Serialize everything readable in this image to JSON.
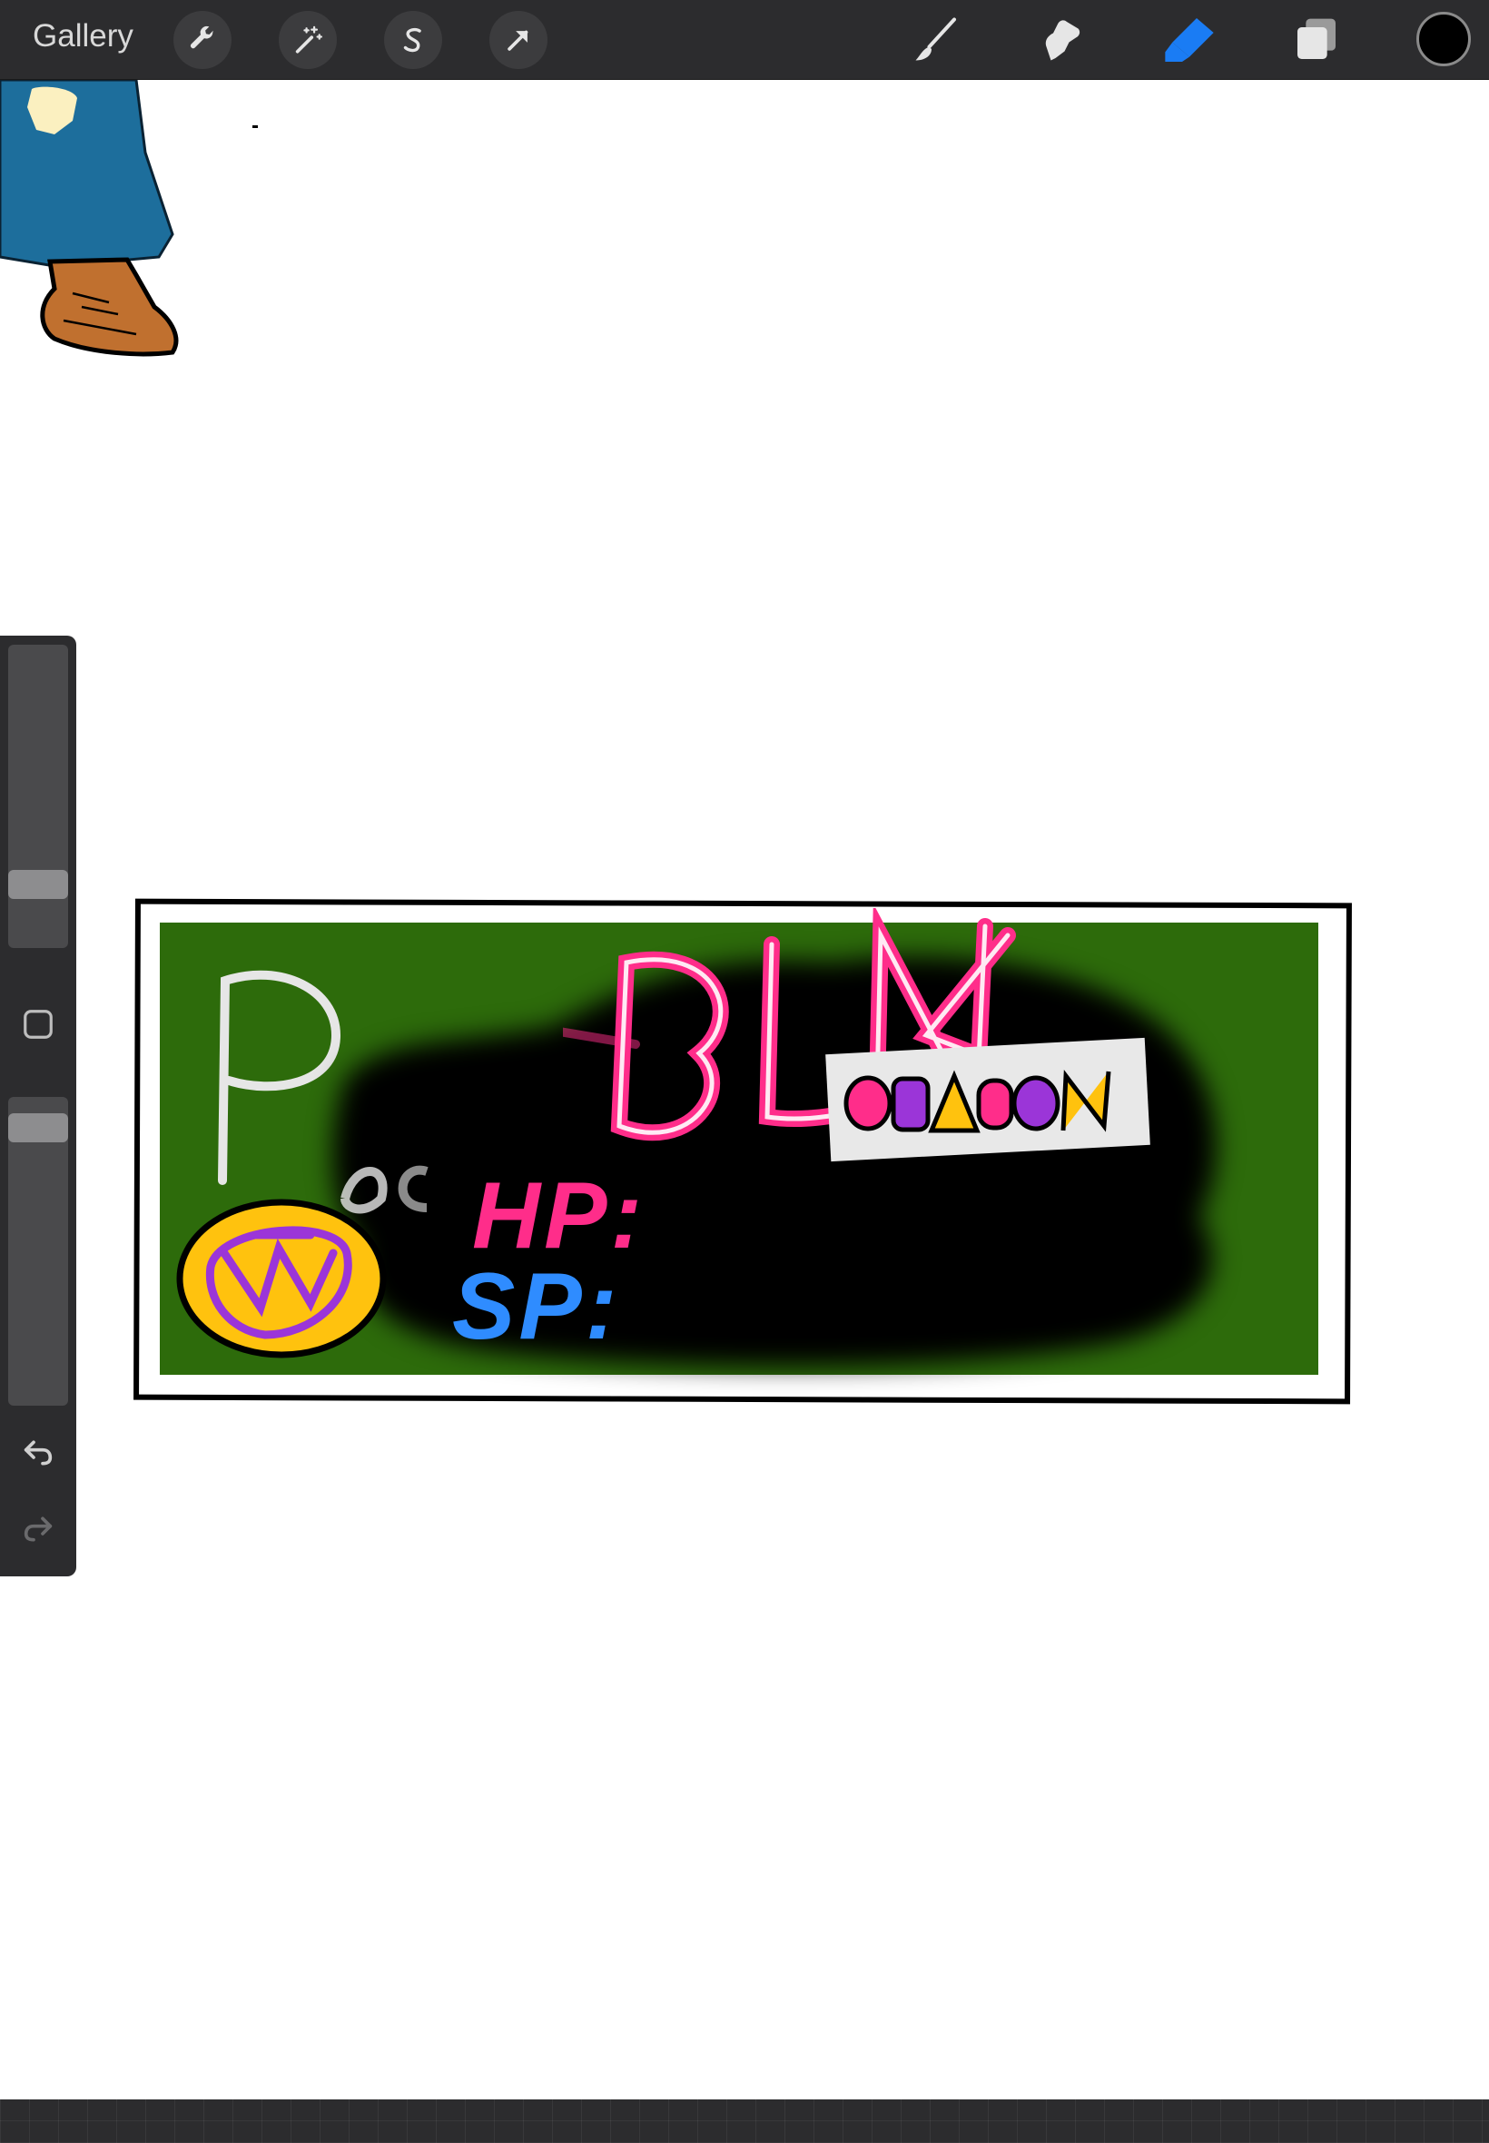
{
  "toolbar": {
    "gallery_label": "Gallery",
    "left_tools": [
      "wrench-icon",
      "magic-wand-icon",
      "selection-s-icon",
      "transform-arrow-icon"
    ],
    "right_tools": [
      "brush-icon",
      "smudge-icon",
      "eraser-icon",
      "layers-icon"
    ],
    "active_tool": "eraser",
    "accent_color": "#1a7cf4",
    "current_color": "#000000"
  },
  "sidebar": {
    "size_slider": 0.18,
    "opacity_slider": 0.94,
    "buttons": [
      "modify-square-icon",
      "undo-icon",
      "redo-icon"
    ]
  },
  "artwork": {
    "banner_letter_p": "P",
    "hp_label": "HP:",
    "sp_label": "SP:",
    "banner_green": "#2d6b0b",
    "hp_color": "#ff2d8a",
    "sp_color": "#2f8cff"
  }
}
